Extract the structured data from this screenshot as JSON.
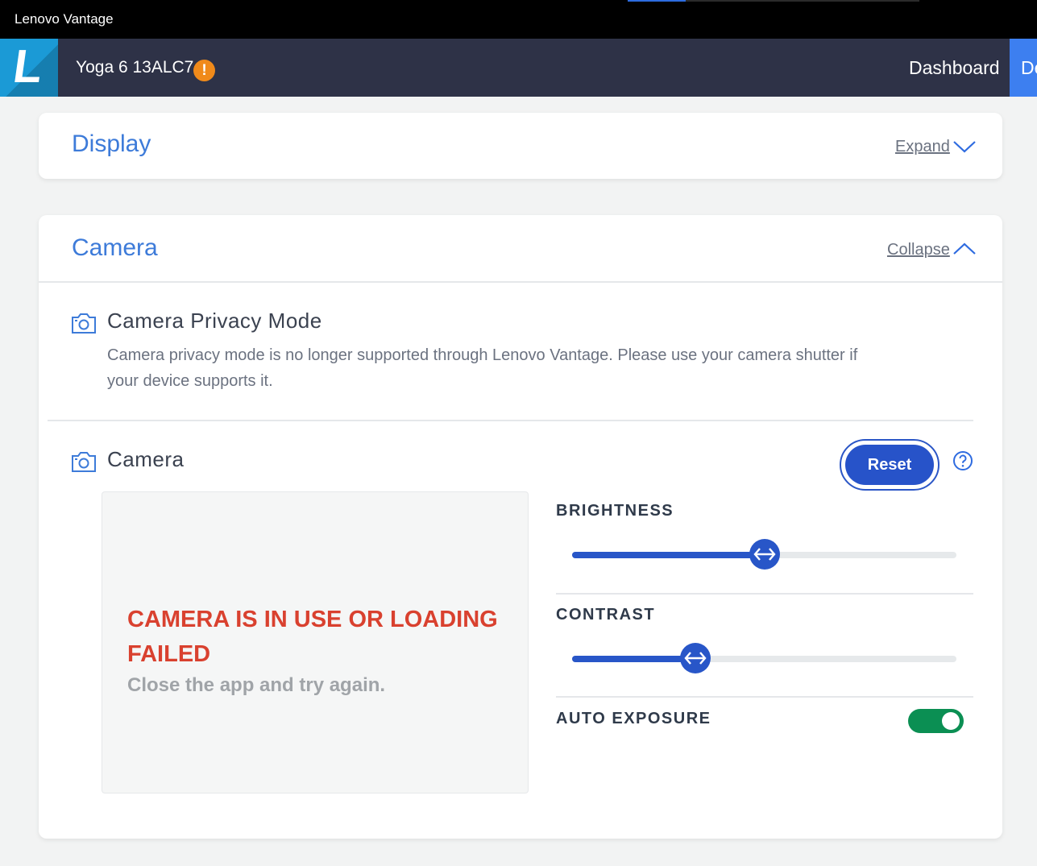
{
  "window": {
    "title": "Lenovo Vantage",
    "loading_progress": 0.2
  },
  "header": {
    "logo_letter": "L",
    "device_name": "Yoga 6 13ALC7",
    "warning_badge": "!",
    "nav": [
      {
        "label": "Dashboard",
        "active": false
      },
      {
        "label": "Device",
        "active": true
      }
    ]
  },
  "display_section": {
    "title": "Display",
    "toggle_label": "Expand"
  },
  "camera_section": {
    "title": "Camera",
    "toggle_label": "Collapse",
    "privacy_mode": {
      "title": "Camera Privacy Mode",
      "description": "Camera privacy mode is no longer supported through Lenovo Vantage. Please use your camera shutter if your device supports it."
    },
    "camera": {
      "title": "Camera",
      "reset_label": "Reset",
      "preview_error": "CAMERA IS IN USE OR LOADING FAILED",
      "preview_hint": "Close the app and try again.",
      "brightness": {
        "label": "BRIGHTNESS",
        "value": 50,
        "min": 0,
        "max": 100
      },
      "contrast": {
        "label": "CONTRAST",
        "value": 32,
        "min": 0,
        "max": 100
      },
      "auto_exposure": {
        "label": "AUTO EXPOSURE",
        "on": true
      }
    }
  },
  "colors": {
    "accent": "#2856c8",
    "link_blue": "#3d7bd9",
    "error": "#d9412f",
    "toggle_on": "#0b8f53",
    "warning": "#f08a1a"
  },
  "icons": {
    "camera": "camera-icon",
    "help": "help-icon",
    "expand": "chevron-down-icon",
    "collapse": "chevron-up-icon",
    "slider_handle": "arrows-horizontal-icon"
  }
}
